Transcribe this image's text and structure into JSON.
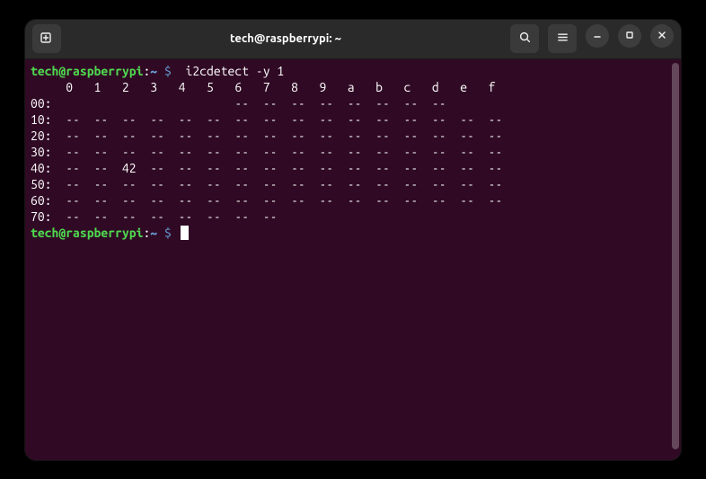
{
  "window": {
    "title": "tech@raspberrypi: ~"
  },
  "prompt": {
    "user_host": "tech@raspberrypi",
    "separator": ":",
    "path": "~",
    "symbol": "$"
  },
  "command": "i2cdetect -y 1",
  "i2c": {
    "header": "     0   1   2   3   4   5   6   7   8   9   a   b   c   d   e   f",
    "rows": [
      {
        "label": "00:",
        "cells": "                          --  --  --  --  --  --  --  --"
      },
      {
        "label": "10:",
        "cells": "  --  --  --  --  --  --  --  --  --  --  --  --  --  --  --  --"
      },
      {
        "label": "20:",
        "cells": "  --  --  --  --  --  --  --  --  --  --  --  --  --  --  --  --"
      },
      {
        "label": "30:",
        "cells": "  --  --  --  --  --  --  --  --  --  --  --  --  --  --  --  --"
      },
      {
        "label": "40:",
        "cells": "  --  --  42  --  --  --  --  --  --  --  --  --  --  --  --  --"
      },
      {
        "label": "50:",
        "cells": "  --  --  --  --  --  --  --  --  --  --  --  --  --  --  --  --"
      },
      {
        "label": "60:",
        "cells": "  --  --  --  --  --  --  --  --  --  --  --  --  --  --  --  --"
      },
      {
        "label": "70:",
        "cells": "  --  --  --  --  --  --  --  --"
      }
    ]
  },
  "icons": {
    "new_tab": "new-tab",
    "search": "search",
    "menu": "menu",
    "minimize": "minimize",
    "maximize": "maximize",
    "close": "close"
  }
}
